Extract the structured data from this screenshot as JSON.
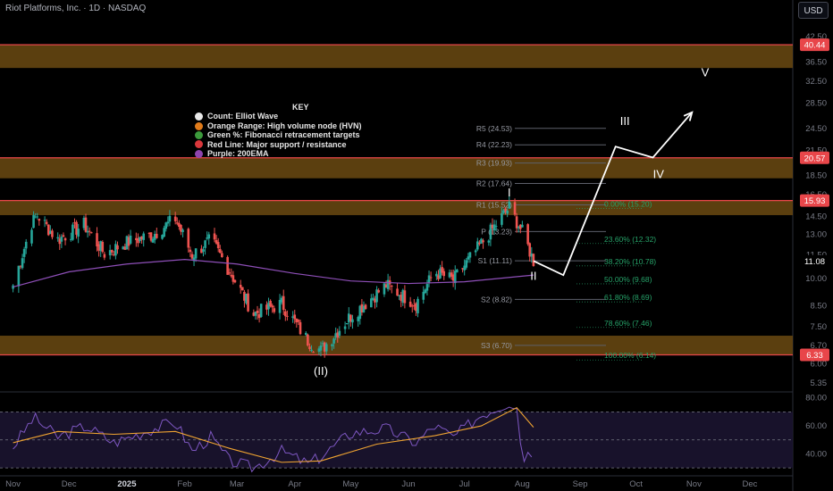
{
  "header": {
    "title": "Riot Platforms, Inc. · 1D · NASDAQ",
    "currency_button": "USD"
  },
  "key": {
    "title": "KEY",
    "items": [
      {
        "label": "Count: Elliot Wave",
        "color": "#e8e8e8"
      },
      {
        "label": "Orange Range: High volume node (HVN)",
        "color": "#e07b1a"
      },
      {
        "label": "Green %: Fibonacci retracement targets",
        "color": "#3c9a3c"
      },
      {
        "label": "Red Line: Major support / resistance",
        "color": "#d9373b"
      },
      {
        "label": "Purple: 200EMA",
        "color": "#8e44ad"
      }
    ]
  },
  "colors": {
    "up": "#26a69a",
    "down": "#ef5350",
    "hvn": "#6b4a12",
    "support": "#e8464a",
    "ema": "#8e4fb8",
    "fib": "#26a269",
    "rsi": "#7e57c2",
    "rsi_ma": "#f0a431",
    "wave": "#ffffff"
  },
  "chart_data": {
    "type": "candlestick",
    "x_axis_labels": [
      "Nov",
      "Dec",
      "2025",
      "Feb",
      "Mar",
      "Apr",
      "May",
      "Jun",
      "Jul",
      "Aug",
      "Sep",
      "Oct",
      "Nov",
      "Dec"
    ],
    "y_axis_labels": [
      "42.50",
      "36.50",
      "32.50",
      "28.50",
      "24.50",
      "21.50",
      "18.50",
      "16.50",
      "14.50",
      "13.00",
      "11.50",
      "10.00",
      "8.50",
      "7.50",
      "6.70",
      "6.00",
      "5.35"
    ],
    "y_log_scale": true,
    "ylim": [
      5.1,
      46
    ],
    "price_badges": [
      {
        "value": "40.44",
        "kind": "support"
      },
      {
        "value": "20.57",
        "kind": "support"
      },
      {
        "value": "15.93",
        "kind": "support"
      },
      {
        "value": "6.33",
        "kind": "support"
      },
      {
        "value": "11.08",
        "kind": "last"
      }
    ],
    "support_lines": [
      40.44,
      20.57,
      15.93,
      6.33
    ],
    "hvn_zones": [
      [
        35.2,
        40.44
      ],
      [
        18.2,
        20.57
      ],
      [
        14.6,
        15.93
      ],
      [
        6.33,
        7.1
      ]
    ],
    "pivots": [
      {
        "label": "R5 (24.53)",
        "value": 24.53
      },
      {
        "label": "R4 (22.23)",
        "value": 22.23
      },
      {
        "label": "R3 (19.93)",
        "value": 19.93
      },
      {
        "label": "R2 (17.64)",
        "value": 17.64
      },
      {
        "label": "R1 (15.52)",
        "value": 15.52
      },
      {
        "label": "P (13.23)",
        "value": 13.23
      },
      {
        "label": "S1 (11.11)",
        "value": 11.11
      },
      {
        "label": "S2 (8.82)",
        "value": 8.82
      },
      {
        "label": "S3 (6.70)",
        "value": 6.7
      }
    ],
    "fib_levels": [
      {
        "label": "0.00% (15.20)",
        "value": 15.2
      },
      {
        "label": "23.60% (12.32)",
        "value": 12.32
      },
      {
        "label": "38.20% (10.78)",
        "value": 10.78
      },
      {
        "label": "50.00% (9.68)",
        "value": 9.68
      },
      {
        "label": "61.80% (8.69)",
        "value": 8.69
      },
      {
        "label": "78.60% (7.46)",
        "value": 7.46
      },
      {
        "label": "100.00% (6.14)",
        "value": 6.14
      }
    ],
    "wave_labels": [
      {
        "label": "(II)",
        "date": "2025-04-15",
        "price": 5.62
      },
      {
        "label": "I",
        "date": "2025-07-25",
        "price": 16.35
      },
      {
        "label": "II",
        "date": "2025-08-07",
        "price": 9.9
      },
      {
        "label": "III",
        "date": "2025-09-25",
        "price": 25.0
      },
      {
        "label": "IV",
        "date": "2025-10-13",
        "price": 18.2
      },
      {
        "label": "V",
        "date": "2025-11-07",
        "price": 33.5
      }
    ],
    "projection": [
      {
        "date": "2025-08-07",
        "price": 11.1
      },
      {
        "date": "2025-08-23",
        "price": 10.2
      },
      {
        "date": "2025-09-20",
        "price": 22.0
      },
      {
        "date": "2025-10-10",
        "price": 20.6
      },
      {
        "date": "2025-10-31",
        "price": 27.0
      }
    ],
    "keypoints": [
      {
        "date": "2024-11-01",
        "price": 9.6
      },
      {
        "date": "2024-11-11",
        "price": 13.9
      },
      {
        "date": "2024-11-14",
        "price": 14.6
      },
      {
        "date": "2024-11-25",
        "price": 12.6
      },
      {
        "date": "2024-12-09",
        "price": 13.8
      },
      {
        "date": "2024-12-20",
        "price": 11.6
      },
      {
        "date": "2025-01-01",
        "price": 12.4
      },
      {
        "date": "2025-01-15",
        "price": 13.0
      },
      {
        "date": "2025-01-27",
        "price": 14.3
      },
      {
        "date": "2025-02-05",
        "price": 11.5
      },
      {
        "date": "2025-02-15",
        "price": 12.6
      },
      {
        "date": "2025-02-22",
        "price": 11.1
      },
      {
        "date": "2025-03-10",
        "price": 8.1
      },
      {
        "date": "2025-03-25",
        "price": 8.6
      },
      {
        "date": "2025-04-08",
        "price": 6.9
      },
      {
        "date": "2025-04-15",
        "price": 6.5
      },
      {
        "date": "2025-05-01",
        "price": 8.0
      },
      {
        "date": "2025-05-20",
        "price": 9.6
      },
      {
        "date": "2025-06-05",
        "price": 8.6
      },
      {
        "date": "2025-06-15",
        "price": 10.4
      },
      {
        "date": "2025-06-25",
        "price": 9.9
      },
      {
        "date": "2025-07-10",
        "price": 12.3
      },
      {
        "date": "2025-07-25",
        "price": 15.3
      },
      {
        "date": "2025-08-01",
        "price": 13.2
      },
      {
        "date": "2025-08-07",
        "price": 11.1
      }
    ],
    "ema_200": [
      {
        "date": "2024-11-01",
        "price": 9.5
      },
      {
        "date": "2024-12-01",
        "price": 10.4
      },
      {
        "date": "2025-01-01",
        "price": 10.9
      },
      {
        "date": "2025-02-01",
        "price": 11.2
      },
      {
        "date": "2025-03-01",
        "price": 10.9
      },
      {
        "date": "2025-04-01",
        "price": 10.3
      },
      {
        "date": "2025-05-01",
        "price": 9.85
      },
      {
        "date": "2025-06-01",
        "price": 9.7
      },
      {
        "date": "2025-07-01",
        "price": 9.8
      },
      {
        "date": "2025-08-07",
        "price": 10.2
      }
    ],
    "rsi": {
      "y_axis_labels": [
        "80.00",
        "60.00",
        "40.00"
      ],
      "ylim": [
        25,
        83
      ],
      "levels": [
        70,
        50,
        30
      ],
      "series": [
        {
          "date": "2024-11-01",
          "value": 45
        },
        {
          "date": "2024-11-12",
          "value": 66
        },
        {
          "date": "2024-11-25",
          "value": 52
        },
        {
          "date": "2024-12-10",
          "value": 60
        },
        {
          "date": "2024-12-25",
          "value": 48
        },
        {
          "date": "2025-01-15",
          "value": 58
        },
        {
          "date": "2025-01-27",
          "value": 63
        },
        {
          "date": "2025-02-05",
          "value": 42
        },
        {
          "date": "2025-02-15",
          "value": 52
        },
        {
          "date": "2025-02-25",
          "value": 35
        },
        {
          "date": "2025-03-10",
          "value": 30
        },
        {
          "date": "2025-03-25",
          "value": 42
        },
        {
          "date": "2025-04-08",
          "value": 33
        },
        {
          "date": "2025-04-15",
          "value": 38
        },
        {
          "date": "2025-05-01",
          "value": 55
        },
        {
          "date": "2025-05-20",
          "value": 58
        },
        {
          "date": "2025-06-05",
          "value": 48
        },
        {
          "date": "2025-06-15",
          "value": 60
        },
        {
          "date": "2025-06-25",
          "value": 52
        },
        {
          "date": "2025-07-10",
          "value": 68
        },
        {
          "date": "2025-07-25",
          "value": 77
        },
        {
          "date": "2025-07-29",
          "value": 73
        },
        {
          "date": "2025-08-01",
          "value": 38
        },
        {
          "date": "2025-08-07",
          "value": 42
        }
      ],
      "ma": [
        {
          "date": "2024-11-01",
          "value": 48
        },
        {
          "date": "2024-11-25",
          "value": 56
        },
        {
          "date": "2024-12-25",
          "value": 54
        },
        {
          "date": "2025-01-27",
          "value": 56
        },
        {
          "date": "2025-02-25",
          "value": 44
        },
        {
          "date": "2025-03-25",
          "value": 34
        },
        {
          "date": "2025-04-15",
          "value": 35
        },
        {
          "date": "2025-05-15",
          "value": 47
        },
        {
          "date": "2025-06-15",
          "value": 53
        },
        {
          "date": "2025-07-10",
          "value": 60
        },
        {
          "date": "2025-07-29",
          "value": 73
        },
        {
          "date": "2025-08-07",
          "value": 59
        }
      ]
    }
  }
}
